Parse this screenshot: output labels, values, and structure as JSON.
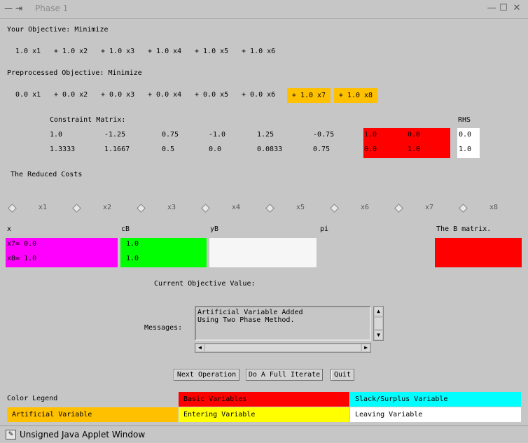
{
  "window": {
    "title": "Phase 1"
  },
  "objective": {
    "label": "Your Objective: Minimize",
    "terms": [
      "1.0 x1",
      "+ 1.0 x2",
      "+ 1.0 x3",
      "+ 1.0 x4",
      "+ 1.0 x5",
      "+ 1.0 x6"
    ]
  },
  "preprocessed": {
    "label": "Preprocessed Objective: Minimize",
    "terms": [
      "0.0 x1",
      "+ 0.0 x2",
      "+ 0.0 x3",
      "+ 0.0 x4",
      "+ 0.0 x5",
      "+ 0.0 x6",
      "+ 1.0 x7",
      "+ 1.0 x8"
    ]
  },
  "constraint": {
    "label": "Constraint Matrix:",
    "rhs_label": "RHS",
    "rows": [
      [
        "1.0",
        "-1.25",
        "0.75",
        "-1.0",
        "1.25",
        "-0.75",
        "1.0",
        "0.0"
      ],
      [
        "1.3333",
        "1.1667",
        "0.5",
        "0.0",
        "0.0833",
        "0.75",
        "0.0",
        "1.0"
      ]
    ],
    "rhs": [
      "0.0",
      "1.0"
    ]
  },
  "reduced_costs": {
    "label": "The Reduced Costs",
    "vars": [
      "x1",
      "x2",
      "x3",
      "x4",
      "x5",
      "x6",
      "x7",
      "x8"
    ]
  },
  "table": {
    "headers": {
      "x": "x",
      "cB": "cB",
      "yB": "yB",
      "pi": "pi",
      "bmatrix": "The B matrix."
    },
    "x": [
      "x7= 0.0",
      "x8= 1.0"
    ],
    "cB": [
      "1.0",
      "1.0"
    ]
  },
  "current_objective_label": "Current Objective Value:",
  "messages": {
    "label": "Messages:",
    "lines": [
      "Artificial Variable Added",
      "Using Two Phase Method."
    ]
  },
  "buttons": {
    "next": "Next Operation",
    "iterate": "Do A Full Iterate",
    "quit": "Quit"
  },
  "legend": {
    "title": "Color Legend",
    "basic": "Basic Variables",
    "slack": "Slack/Surplus Variable",
    "artificial": "Artificial Variable",
    "entering": "Entering Variable",
    "leaving": "Leaving Variable"
  },
  "colors": {
    "basic": "#ff0000",
    "slack": "#00ffff",
    "artificial": "#ffc000",
    "entering": "#ffff00",
    "leaving": "#ffffff",
    "x_col": "#ff00ff",
    "cb_col": "#00ff00"
  },
  "statusbar": {
    "text": "Unsigned Java Applet Window"
  }
}
